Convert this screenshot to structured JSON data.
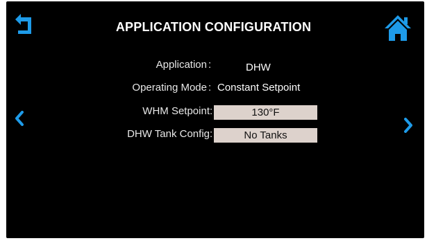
{
  "header": {
    "title": "APPLICATION CONFIGURATION",
    "back_icon": "back-arrow-icon",
    "home_icon": "home-icon"
  },
  "navigation": {
    "prev_icon": "chevron-left-icon",
    "next_icon": "chevron-right-icon"
  },
  "rows": [
    {
      "label": "Application",
      "separator": ":",
      "value": "DHW"
    },
    {
      "label": "Operating Mode",
      "separator": ":",
      "value": "Constant Setpoint"
    },
    {
      "label": "WHM Setpoint",
      "separator": ":",
      "value": "130°F"
    },
    {
      "label": "DHW Tank Config",
      "separator": ":",
      "value": "No Tanks"
    }
  ],
  "colors": {
    "accent": "#1e9be9",
    "background": "#000000",
    "field": "#ddd2cc"
  }
}
